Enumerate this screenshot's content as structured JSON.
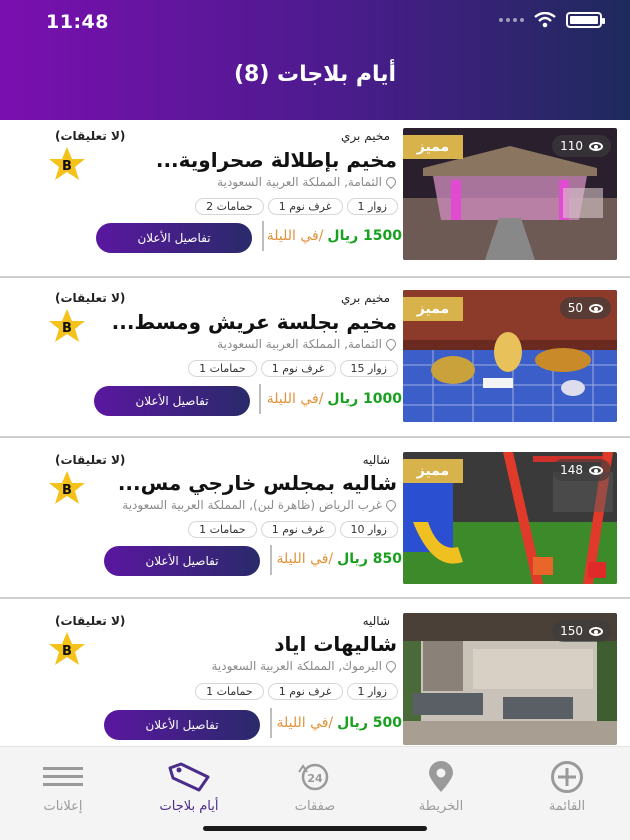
{
  "status": {
    "time": "11:48"
  },
  "header": {
    "title": "أيام بلاجات (8)"
  },
  "listings": [
    {
      "category": "مخيم بري",
      "comments": "(لا تعليقات)",
      "title": "مخيم بإطلالة صحراوية...",
      "rating_badge": "B",
      "location": "الثمامة, المملكة العربية السعودية",
      "chips": [
        "زوار 1",
        "غرف نوم 1",
        "حمامات 2"
      ],
      "price_amount": "1500 ريال",
      "price_unit": "/في الليلة",
      "button": "تفاصيل الأعلان",
      "badge": "مميز",
      "views": "110"
    },
    {
      "category": "مخيم بري",
      "comments": "(لا تعليقات)",
      "title": "مخيم بجلسة عريش ومسط...",
      "rating_badge": "B",
      "location": "الثمامة, المملكة العربية السعودية",
      "chips": [
        "زوار 15",
        "غرف نوم 1",
        "حمامات 1"
      ],
      "price_amount": "1000 ريال",
      "price_unit": "/في الليلة",
      "button": "تفاصيل الأعلان",
      "badge": "مميز",
      "views": "50"
    },
    {
      "category": "شاليه",
      "comments": "(لا تعليقات)",
      "title": "شاليه بمجلس خارجي مس...",
      "rating_badge": "B",
      "location": "غرب الرياض (ظاهرة لبن), المملكة العربية السعودية",
      "chips": [
        "زوار 10",
        "غرف نوم 1",
        "حمامات 1"
      ],
      "price_amount": "850 ريال",
      "price_unit": "/في الليلة",
      "button": "تفاصيل الأعلان",
      "badge": "مميز",
      "views": "148"
    },
    {
      "category": "شاليه",
      "comments": "(لا تعليقات)",
      "title": "شاليهات اياد",
      "rating_badge": "B",
      "location": "اليرموك, المملكة العربية السعودية",
      "chips": [
        "زوار 1",
        "غرف نوم 1",
        "حمامات 1"
      ],
      "price_amount": "500 ريال",
      "price_unit": "/في الليلة",
      "button": "تفاصيل الأعلان",
      "views": "150"
    }
  ],
  "nav": [
    {
      "label": "إعلانات",
      "icon": "menu-lines-icon"
    },
    {
      "label": "أيام بلاجات",
      "icon": "tag-icon",
      "active": true
    },
    {
      "label": "صفقات",
      "icon": "24h-icon"
    },
    {
      "label": "الخريطة",
      "icon": "map-pin-icon"
    },
    {
      "label": "القائمة",
      "icon": "plus-circle-icon"
    }
  ],
  "colors": {
    "accent": "#4a2c8a",
    "price": "#18a01e",
    "unit": "#e0923a",
    "badge": "#d8b24a"
  }
}
